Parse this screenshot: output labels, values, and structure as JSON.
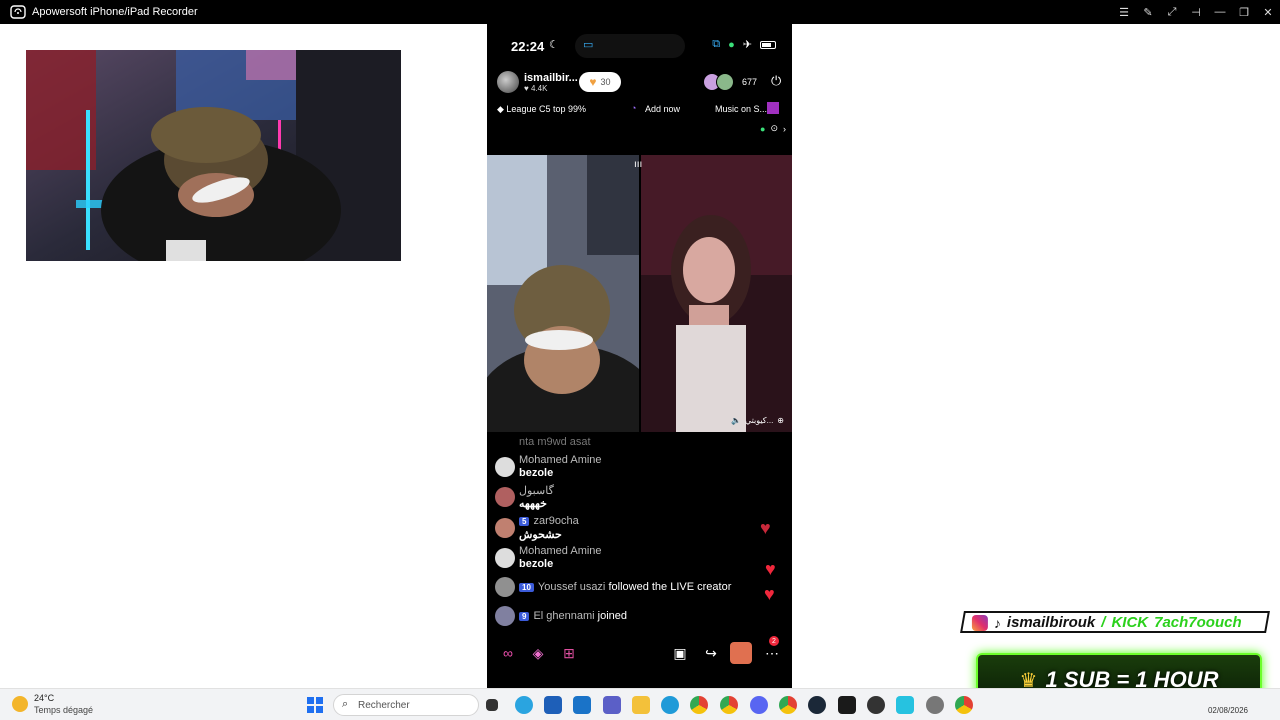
{
  "recorder": {
    "title": "Apowersoft iPhone/iPad Recorder",
    "controls": [
      "list-icon",
      "edit-icon",
      "fullscreen-icon",
      "pin-icon",
      "minimize-icon",
      "restore-icon",
      "close-icon"
    ]
  },
  "phone": {
    "status": {
      "time": "22:24"
    },
    "host": {
      "name": "ismailbir...",
      "likes": "4.4K",
      "like_pill": "30"
    },
    "viewers": {
      "count": "677"
    },
    "info": {
      "league": "League C5 top 99%",
      "add_now": "Add now",
      "music": "Music on S..."
    },
    "guest": {
      "name": "كيوبتي..."
    },
    "chat": [
      {
        "name": "nta m9wd asat",
        "text": ""
      },
      {
        "name": "Mohamed Amine",
        "text": "bezole"
      },
      {
        "name": "گاسبول",
        "text": "خهههه"
      },
      {
        "level": "5",
        "name": "zar9ocha",
        "text": "حشحوش"
      },
      {
        "name": "Mohamed Amine",
        "text": "bezole"
      },
      {
        "level": "10",
        "name": "Youssef usazi",
        "text": "followed the LIVE creator"
      },
      {
        "level": "9",
        "name": "El ghennami",
        "text": "joined"
      }
    ],
    "notifications": "2"
  },
  "overlay": {
    "social_handle": "ismailbirouk",
    "kick": "KICK",
    "kick_handle": "7ach7oouch",
    "sub_text": "1 SUB = 1 HOUR"
  },
  "taskbar": {
    "temp": "24°C",
    "weather": "Temps dégagé",
    "search_placeholder": "Rechercher",
    "date": "02/08/2026"
  },
  "colors": {
    "heart": "#f0283c",
    "accent_green": "#6cff2a",
    "level_badge": "#3b5bd9"
  }
}
